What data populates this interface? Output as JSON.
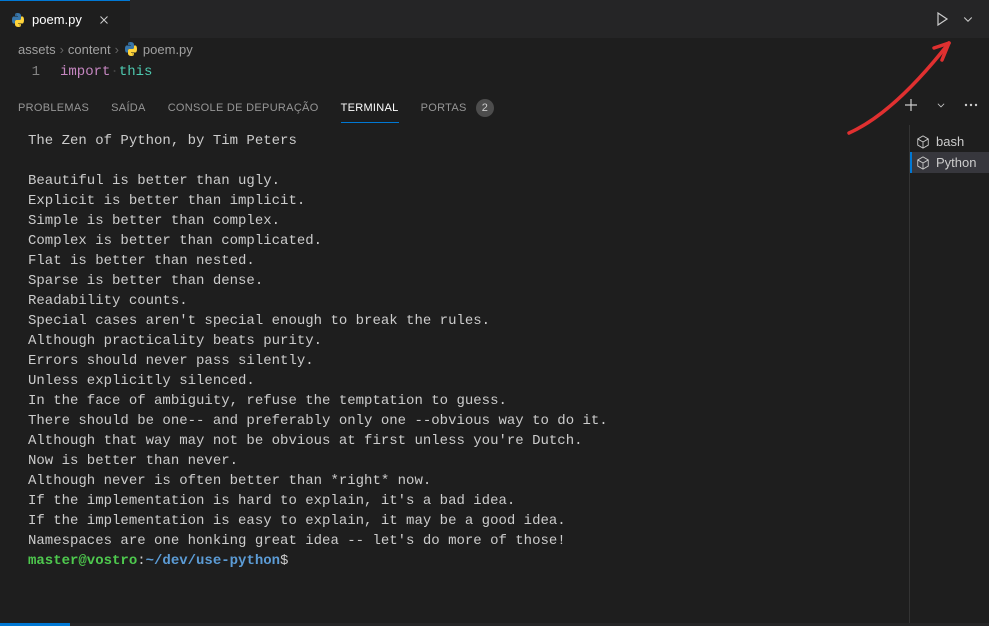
{
  "tabs": {
    "file_icon": "python-icon",
    "file_name": "poem.py"
  },
  "breadcrumb": {
    "parts": [
      "assets",
      "content"
    ],
    "file_name": "poem.py"
  },
  "editor": {
    "line_number": "1",
    "keyword": "import",
    "module": "this"
  },
  "panel": {
    "tabs": {
      "problems": "PROBLEMAS",
      "output": "SAÍDA",
      "debug": "CONSOLE DE DEPURAÇÃO",
      "terminal": "TERMINAL",
      "ports": "PORTAS",
      "ports_badge": "2"
    }
  },
  "terminal": {
    "output": "The Zen of Python, by Tim Peters\n\nBeautiful is better than ugly.\nExplicit is better than implicit.\nSimple is better than complex.\nComplex is better than complicated.\nFlat is better than nested.\nSparse is better than dense.\nReadability counts.\nSpecial cases aren't special enough to break the rules.\nAlthough practicality beats purity.\nErrors should never pass silently.\nUnless explicitly silenced.\nIn the face of ambiguity, refuse the temptation to guess.\nThere should be one-- and preferably only one --obvious way to do it.\nAlthough that way may not be obvious at first unless you're Dutch.\nNow is better than never.\nAlthough never is often better than *right* now.\nIf the implementation is hard to explain, it's a bad idea.\nIf the implementation is easy to explain, it may be a good idea.\nNamespaces are one honking great idea -- let's do more of those!",
    "prompt_user": "master@vostro",
    "prompt_path": "~/dev/use-python",
    "prompt_end": "$",
    "sidebar": {
      "bash": "bash",
      "python": "Python"
    }
  }
}
